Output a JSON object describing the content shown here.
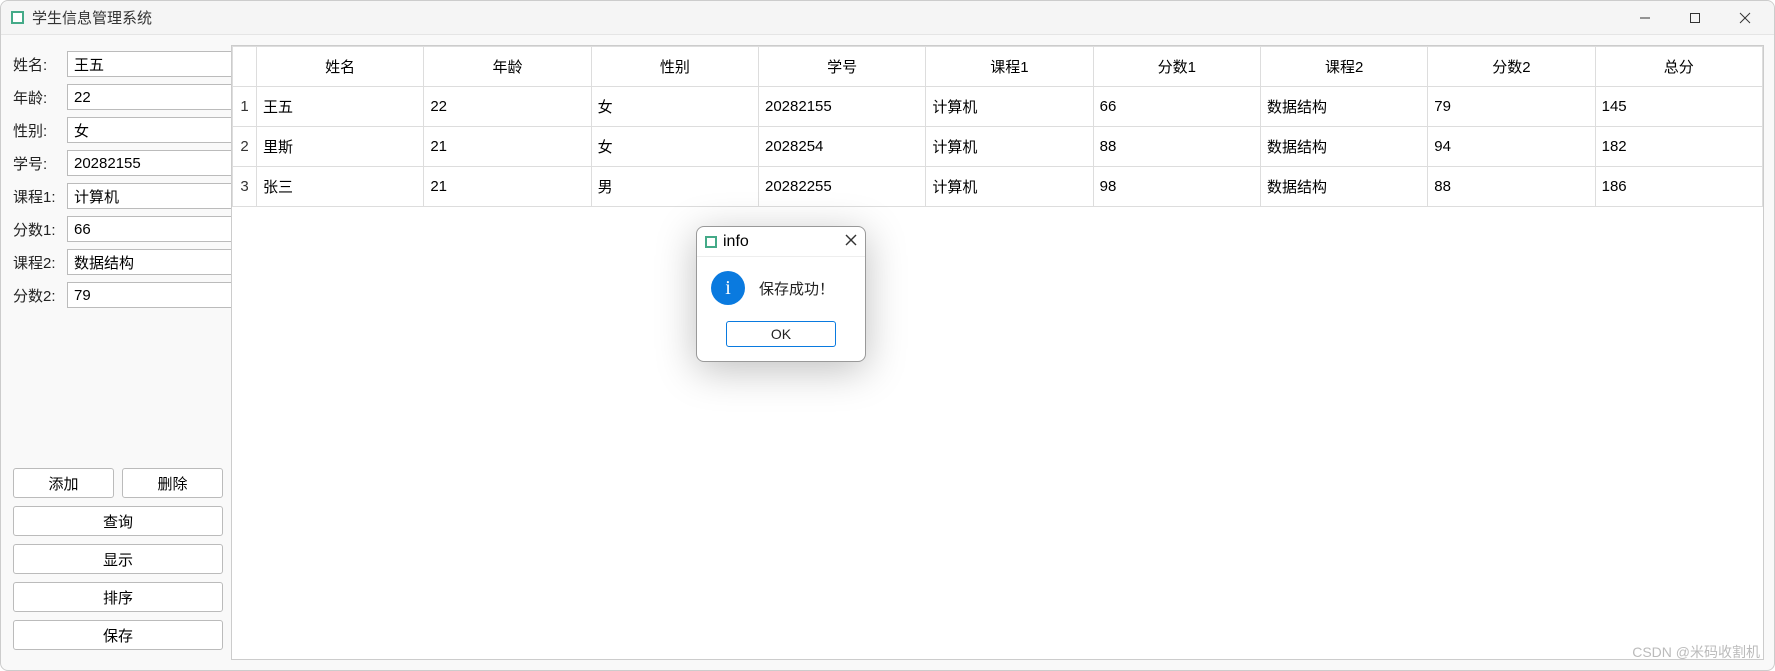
{
  "window": {
    "title": "学生信息管理系统"
  },
  "form": {
    "name": {
      "label": "姓名:",
      "value": "王五"
    },
    "age": {
      "label": "年龄:",
      "value": "22"
    },
    "gender": {
      "label": "性别:",
      "value": "女"
    },
    "sid": {
      "label": "学号:",
      "value": "20282155"
    },
    "course1": {
      "label": "课程1:",
      "value": "计算机"
    },
    "score1": {
      "label": "分数1:",
      "value": "66"
    },
    "course2": {
      "label": "课程2:",
      "value": "数据结构"
    },
    "score2": {
      "label": "分数2:",
      "value": "79"
    }
  },
  "buttons": {
    "add": "添加",
    "delete": "删除",
    "query": "查询",
    "show": "显示",
    "sort": "排序",
    "save": "保存"
  },
  "table": {
    "headers": [
      "姓名",
      "年龄",
      "性别",
      "学号",
      "课程1",
      "分数1",
      "课程2",
      "分数2",
      "总分"
    ],
    "rows": [
      {
        "idx": "1",
        "cells": [
          "王五",
          "22",
          "女",
          "20282155",
          "计算机",
          "66",
          "数据结构",
          "79",
          "145"
        ]
      },
      {
        "idx": "2",
        "cells": [
          "里斯",
          "21",
          "女",
          "2028254",
          "计算机",
          "88",
          "数据结构",
          "94",
          "182"
        ]
      },
      {
        "idx": "3",
        "cells": [
          "张三",
          "21",
          "男",
          "20282255",
          "计算机",
          "98",
          "数据结构",
          "88",
          "186"
        ]
      }
    ]
  },
  "dialog": {
    "title": "info",
    "message": "保存成功！",
    "ok": "OK"
  },
  "watermark": "CSDN @米码收割机"
}
